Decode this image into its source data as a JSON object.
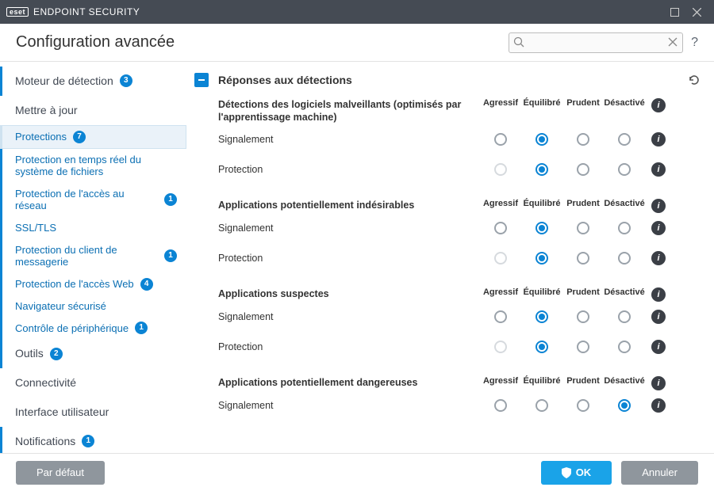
{
  "titlebar": {
    "brand_box": "eset",
    "brand_text": "ENDPOINT SECURITY"
  },
  "header": {
    "title": "Configuration avancée",
    "search_placeholder": ""
  },
  "sidebar": {
    "motor": {
      "label": "Moteur de détection",
      "badge": "3"
    },
    "update": {
      "label": "Mettre à jour"
    },
    "protections": {
      "label": "Protections",
      "badge": "7"
    },
    "sub": {
      "realtime": {
        "label": "Protection en temps réel du système de fichiers"
      },
      "network": {
        "label": "Protection de l'accès au réseau",
        "badge": "1"
      },
      "ssl": {
        "label": "SSL/TLS"
      },
      "mail": {
        "label": "Protection du client de messagerie",
        "badge": "1"
      },
      "web": {
        "label": "Protection de l'accès Web",
        "badge": "4"
      },
      "browser": {
        "label": "Navigateur sécurisé"
      },
      "device": {
        "label": "Contrôle de périphérique",
        "badge": "1"
      }
    },
    "tools": {
      "label": "Outils",
      "badge": "2"
    },
    "connect": {
      "label": "Connectivité"
    },
    "ui": {
      "label": "Interface utilisateur"
    },
    "notif": {
      "label": "Notifications",
      "badge": "1"
    }
  },
  "section": {
    "title": "Réponses aux détections"
  },
  "columns": {
    "c0": "Agressif",
    "c1": "Équilibré",
    "c2": "Prudent",
    "c3": "Désactivé"
  },
  "rows": {
    "reporting": "Signalement",
    "protection": "Protection"
  },
  "groups": {
    "g0": {
      "title": "Détections des logiciels malveillants (optimisés par l'apprentissage machine)"
    },
    "g1": {
      "title": "Applications potentiellement indésirables"
    },
    "g2": {
      "title": "Applications suspectes"
    },
    "g3": {
      "title": "Applications potentiellement dangereuses"
    }
  },
  "footer": {
    "default": "Par défaut",
    "ok": "OK",
    "cancel": "Annuler"
  },
  "radio_state": {
    "g0": {
      "reporting": {
        "selected": 1,
        "disabled": []
      },
      "protection": {
        "selected": 1,
        "disabled": [
          0
        ]
      }
    },
    "g1": {
      "reporting": {
        "selected": 1,
        "disabled": []
      },
      "protection": {
        "selected": 1,
        "disabled": [
          0
        ]
      }
    },
    "g2": {
      "reporting": {
        "selected": 1,
        "disabled": []
      },
      "protection": {
        "selected": 1,
        "disabled": [
          0
        ]
      }
    },
    "g3": {
      "reporting": {
        "selected": 3,
        "disabled": []
      }
    }
  }
}
